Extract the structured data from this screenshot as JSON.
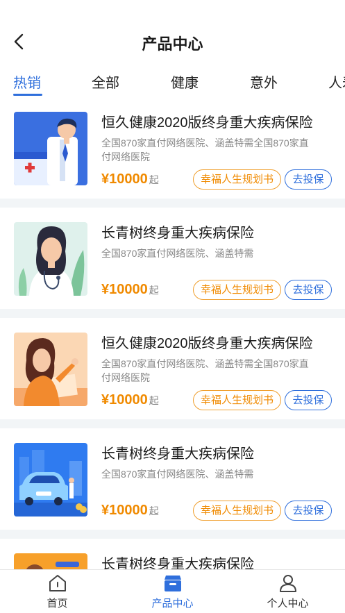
{
  "header": {
    "title": "产品中心",
    "back_icon": "chevron-left-icon"
  },
  "tabs": [
    {
      "label": "热销",
      "active": true
    },
    {
      "label": "全部"
    },
    {
      "label": "健康"
    },
    {
      "label": "意外"
    },
    {
      "label": "人寿"
    }
  ],
  "products": [
    {
      "title": "恒久健康2020版终身重大疾病保险",
      "desc": "全国870家直付网络医院、涵盖特需全国870家直付网络医院",
      "price": "¥10000",
      "price_suffix": "起",
      "plan_label": "幸福人生规划书",
      "buy_label": "去投保",
      "thumb": "doctor-male"
    },
    {
      "title": "长青树终身重大疾病保险",
      "desc": "全国870家直付网络医院、涵盖特需",
      "price": "¥10000",
      "price_suffix": "起",
      "plan_label": "幸福人生规划书",
      "buy_label": "去投保",
      "thumb": "doctor-female"
    },
    {
      "title": "恒久健康2020版终身重大疾病保险",
      "desc": "全国870家直付网络医院、涵盖特需全国870家直付网络医院",
      "price": "¥10000",
      "price_suffix": "起",
      "plan_label": "幸福人生规划书",
      "buy_label": "去投保",
      "thumb": "teacher-female"
    },
    {
      "title": "长青树终身重大疾病保险",
      "desc": "全国870家直付网络医院、涵盖特需",
      "price": "¥10000",
      "price_suffix": "起",
      "plan_label": "幸福人生规划书",
      "buy_label": "去投保",
      "thumb": "car"
    },
    {
      "title": "长青树终身重大疾病保险",
      "thumb": "orange-partial"
    }
  ],
  "bottom_nav": [
    {
      "label": "首页",
      "icon": "home-icon"
    },
    {
      "label": "产品中心",
      "icon": "product-box-icon",
      "active": true
    },
    {
      "label": "个人中心",
      "icon": "user-icon"
    }
  ],
  "colors": {
    "accent": "#2f6fdc",
    "price": "#f08a00",
    "plan_border": "#f0a030"
  }
}
